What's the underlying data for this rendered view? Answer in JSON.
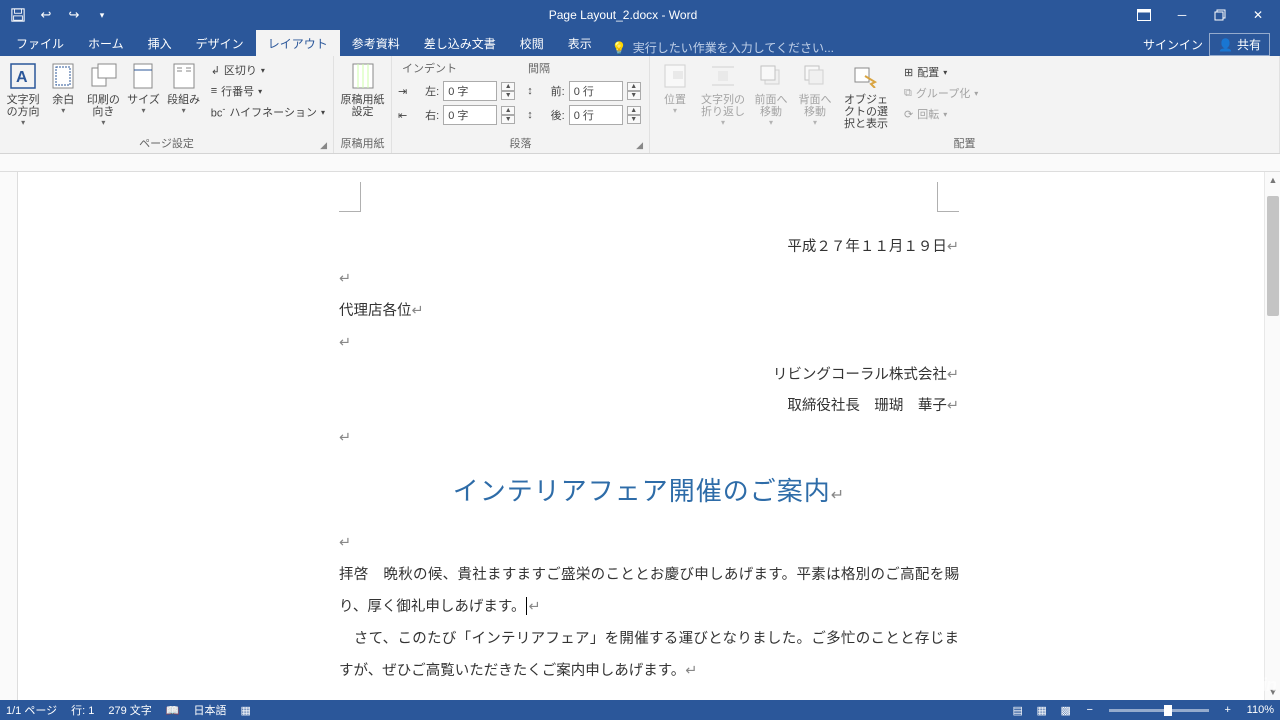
{
  "title_bar": {
    "doc_title": "Page Layout_2.docx - Word"
  },
  "tabs": {
    "file": "ファイル",
    "home": "ホーム",
    "insert": "挿入",
    "design": "デザイン",
    "layout": "レイアウト",
    "references": "参考資料",
    "mailings": "差し込み文書",
    "review": "校閲",
    "view": "表示",
    "tell_me": "実行したい作業を入力してください...",
    "signin": "サインイン",
    "share": "共有"
  },
  "ribbon": {
    "page_setup": {
      "text_direction": "文字列の方向",
      "margins": "余白",
      "orientation": "印刷の向き",
      "size": "サイズ",
      "columns": "段組み",
      "breaks": "区切り",
      "line_numbers": "行番号",
      "hyphenation": "ハイフネーション",
      "group_label": "ページ設定"
    },
    "manuscript": {
      "button": "原稿用紙設定",
      "group_label": "原稿用紙"
    },
    "paragraph": {
      "indent_label": "インデント",
      "spacing_label": "間隔",
      "left_label": "左:",
      "right_label": "右:",
      "before_label": "前:",
      "after_label": "後:",
      "left_value": "0 字",
      "right_value": "0 字",
      "before_value": "0 行",
      "after_value": "0 行",
      "group_label": "段落"
    },
    "arrange": {
      "position": "位置",
      "wrap_text": "文字列の折り返し",
      "bring_forward": "前面へ移動",
      "send_backward": "背面へ移動",
      "selection_pane": "オブジェクトの選択と表示",
      "align": "配置",
      "group": "グループ化",
      "rotate": "回転",
      "group_label": "配置"
    }
  },
  "document": {
    "date": "平成２７年１１月１９日",
    "recipient": "代理店各位",
    "company": "リビングコーラル株式会社",
    "sender": "取締役社長　珊瑚　華子",
    "title": "インテリアフェア開催のご案内",
    "body1": "拝啓　晩秋の候、貴社ますますご盛栄のこととお慶び申しあげます。平素は格別のご高配を賜り、厚く御礼申しあげます。",
    "body2": "　さて、このたび「インテリアフェア」を開催する運びとなりました。ご多忙のことと存じますが、ぜひご高覧いただきたくご案内申しあげます。"
  },
  "status": {
    "page": "1/1 ページ",
    "line": "行: 1",
    "words": "279 文字",
    "language": "日本語",
    "zoom": "110%"
  }
}
